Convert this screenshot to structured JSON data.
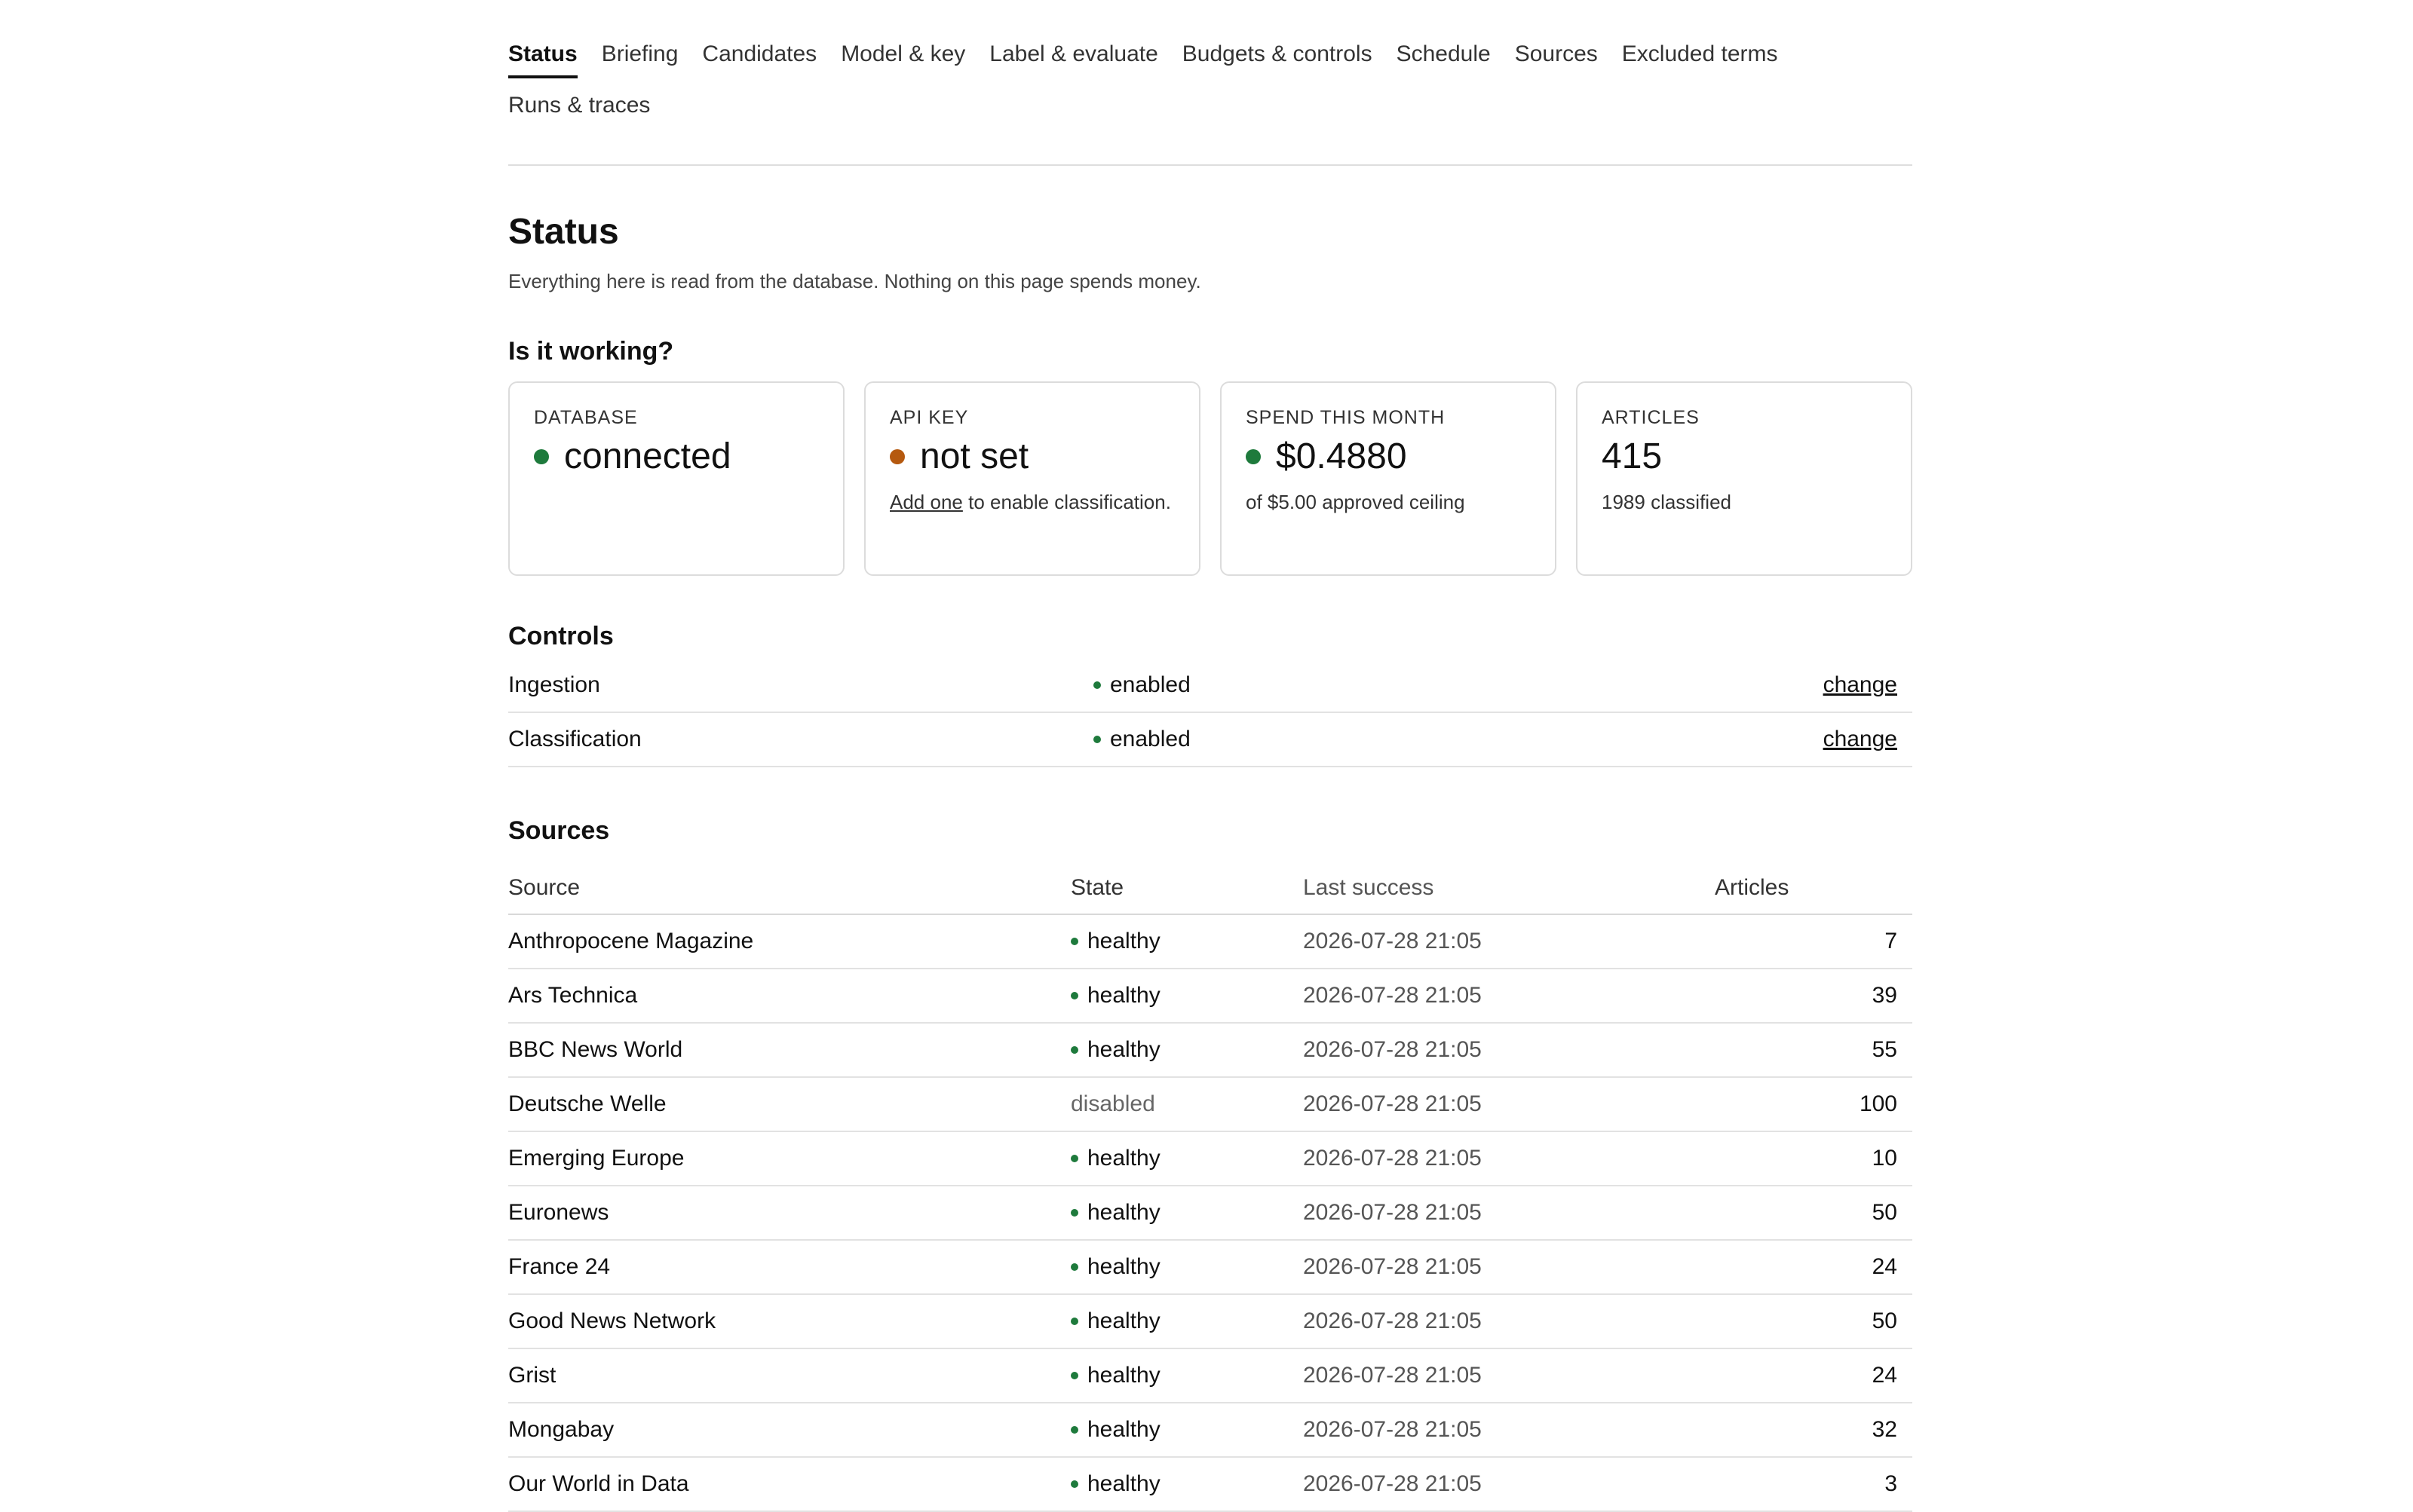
{
  "colors": {
    "ok": "#1e7a3c",
    "warn": "#b5590f"
  },
  "tabs": [
    {
      "label": "Status",
      "active": true
    },
    {
      "label": "Briefing"
    },
    {
      "label": "Candidates"
    },
    {
      "label": "Model & key"
    },
    {
      "label": "Label & evaluate"
    },
    {
      "label": "Budgets & controls"
    },
    {
      "label": "Schedule"
    },
    {
      "label": "Sources"
    },
    {
      "label": "Excluded terms"
    },
    {
      "label": "Runs & traces"
    }
  ],
  "page": {
    "title": "Status",
    "subtitle": "Everything here is read from the database. Nothing on this page spends money."
  },
  "working": {
    "heading": "Is it working?",
    "database": {
      "label": "DATABASE",
      "value": "connected",
      "status": "ok"
    },
    "api_key": {
      "label": "API KEY",
      "value": "not set",
      "status": "warn",
      "link": "Add one",
      "note_rest": " to enable classification."
    },
    "spend": {
      "label": "SPEND THIS MONTH",
      "value": "$0.4880",
      "status": "ok",
      "note": "of $5.00 approved ceiling"
    },
    "articles": {
      "label": "ARTICLES",
      "value": "415",
      "note": "1989 classified"
    }
  },
  "controls": {
    "heading": "Controls",
    "rows": [
      {
        "name": "Ingestion",
        "state": "enabled",
        "action": "change"
      },
      {
        "name": "Classification",
        "state": "enabled",
        "action": "change"
      }
    ]
  },
  "sources": {
    "heading": "Sources",
    "columns": {
      "source": "Source",
      "state": "State",
      "last": "Last success",
      "articles": "Articles"
    },
    "rows": [
      {
        "source": "Anthropocene Magazine",
        "state": "healthy",
        "last": "2026-07-28 21:05",
        "articles": "7"
      },
      {
        "source": "Ars Technica",
        "state": "healthy",
        "last": "2026-07-28 21:05",
        "articles": "39"
      },
      {
        "source": "BBC News World",
        "state": "healthy",
        "last": "2026-07-28 21:05",
        "articles": "55"
      },
      {
        "source": "Deutsche Welle",
        "state": "disabled",
        "last": "2026-07-28 21:05",
        "articles": "100"
      },
      {
        "source": "Emerging Europe",
        "state": "healthy",
        "last": "2026-07-28 21:05",
        "articles": "10"
      },
      {
        "source": "Euronews",
        "state": "healthy",
        "last": "2026-07-28 21:05",
        "articles": "50"
      },
      {
        "source": "France 24",
        "state": "healthy",
        "last": "2026-07-28 21:05",
        "articles": "24"
      },
      {
        "source": "Good News Network",
        "state": "healthy",
        "last": "2026-07-28 21:05",
        "articles": "50"
      },
      {
        "source": "Grist",
        "state": "healthy",
        "last": "2026-07-28 21:05",
        "articles": "24"
      },
      {
        "source": "Mongabay",
        "state": "healthy",
        "last": "2026-07-28 21:05",
        "articles": "32"
      },
      {
        "source": "Our World in Data",
        "state": "healthy",
        "last": "2026-07-28 21:05",
        "articles": "3"
      }
    ]
  }
}
